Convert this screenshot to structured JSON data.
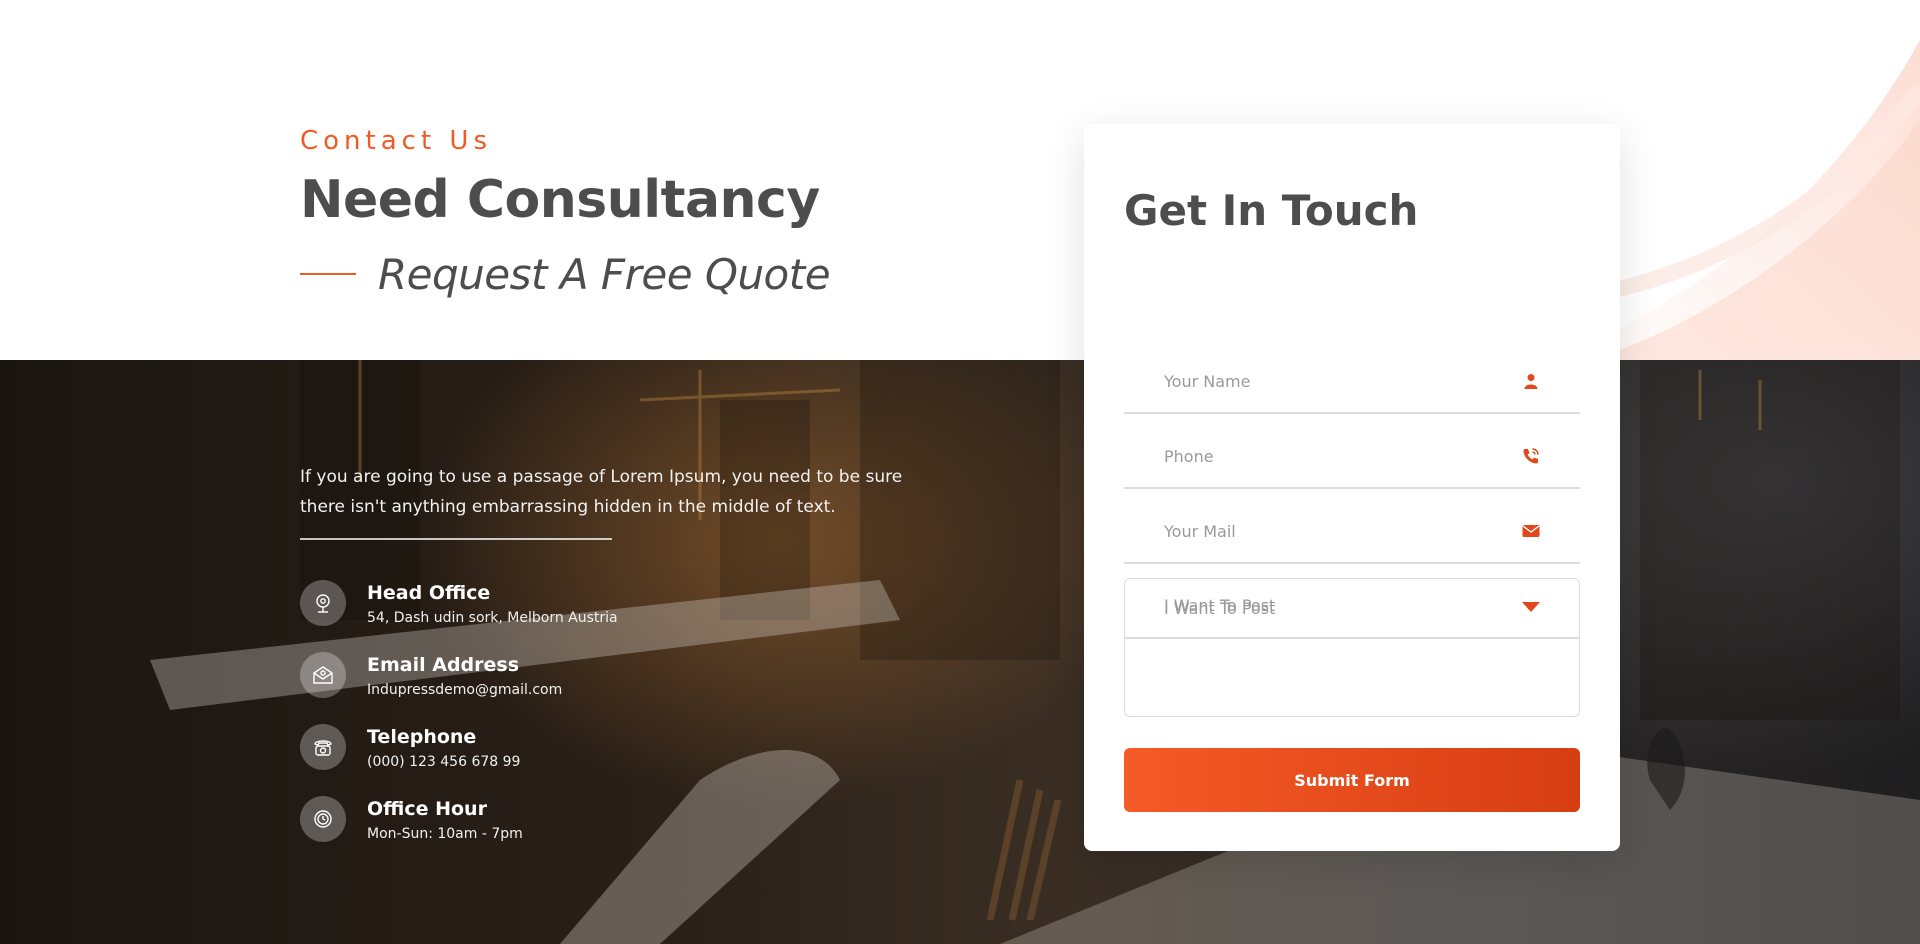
{
  "hero": {
    "kicker": "Contact Us",
    "headline": "Need Consultancy",
    "subheadline": "Request A Free Quote"
  },
  "intro": {
    "text": "If you are going to use a passage of Lorem Ipsum, you need to be sure there isn't anything embarrassing hidden in the middle of text."
  },
  "contact_info": {
    "items": [
      {
        "title": "Head Office",
        "text": "54, Dash udin sork, Melborn Austria",
        "icon": "location-icon"
      },
      {
        "title": "Email Address",
        "text": "Indupressdemo@gmail.com",
        "icon": "envelope-icon"
      },
      {
        "title": "Telephone",
        "text": "(000) 123 456 678 99",
        "icon": "telephone-icon"
      },
      {
        "title": "Office Hour",
        "text": "Mon-Sun: 10am - 7pm",
        "icon": "clock-icon"
      }
    ]
  },
  "form": {
    "title": "Get In Touch",
    "name_placeholder": "Your Name",
    "phone_placeholder": "Phone",
    "mail_placeholder": "Your Mail",
    "post_select": "I Want To Post",
    "message_placeholder": "I Want To Post",
    "submit_label": "Submit Form"
  },
  "colors": {
    "accent": "#f15a24",
    "heading": "#4d4d4d",
    "button_start": "#f65a27",
    "button_end": "#d63d12"
  }
}
